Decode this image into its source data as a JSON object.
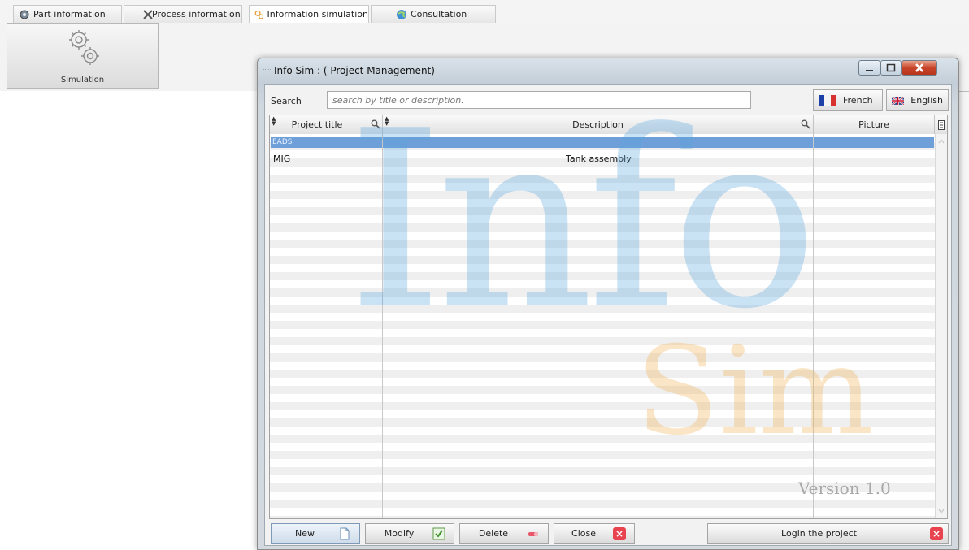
{
  "top_tabs": [
    {
      "label": "Part information",
      "icon": "gear-globe-icon"
    },
    {
      "label": "Process information",
      "icon": "tools-icon"
    },
    {
      "label": "Information simulation",
      "icon": "gears-icon"
    },
    {
      "label": "Consultation",
      "icon": "globe-icon"
    }
  ],
  "ribbon": {
    "simulation_label": "Simulation",
    "icon": "gears-icon"
  },
  "window": {
    "title": "Info Sim : ( Project Management)",
    "search_label": "Search",
    "search_placeholder": "search by title or description.",
    "search_value": "",
    "lang_french": "French",
    "lang_english": "English",
    "columns": [
      "Project title",
      "Description",
      "Picture"
    ],
    "group": "EADS",
    "rows": [
      {
        "title": "MIG",
        "description": "Tank assembly",
        "picture": ""
      }
    ],
    "watermark": {
      "big": "Info",
      "small": "Sim",
      "version": "Version 1.0"
    },
    "buttons": {
      "new": "New",
      "modify": "Modify",
      "delete": "Delete",
      "close": "Close",
      "login": "Login the project"
    }
  },
  "colors": {
    "group_row": "#6f9fd8",
    "watermark_blue": "#5aa6df",
    "watermark_orange": "#f0b350",
    "close_red": "#e8434f"
  }
}
